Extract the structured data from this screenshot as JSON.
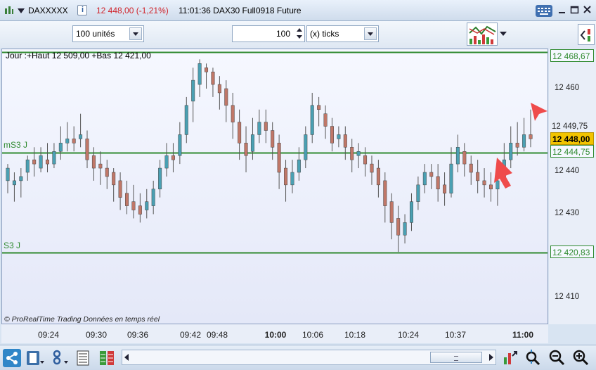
{
  "titlebar": {
    "instrument": "DAXXXXX",
    "info_icon": "i",
    "price_change": "12 448,00 (-1,21%)",
    "time_and_name": "11:01:36 DAX30 Full0918 Future",
    "colors": {
      "negative": "#d0232a"
    }
  },
  "toolbar": {
    "quantity": "100 unités",
    "step_value": "100",
    "step_unit": "(x) ticks"
  },
  "chart": {
    "header": "Jour :+Haut 12 509,00 +Bas 12 421,00",
    "label_ms3": "mS3 J",
    "label_s3": "S3 J",
    "footer_brand": "© ProRealTime Trading",
    "footer_realtime": "Données en temps réel",
    "colors": {
      "up": "#4aa0b3",
      "down": "#c07768",
      "level_line": "#2f8a2f",
      "last_price_bg": "#f2c400"
    }
  },
  "price_axis": {
    "tick_12460": "12 460",
    "tick_12440": "12 440",
    "tick_12430": "12 430",
    "tick_12410": "12 410",
    "level_high": "12 468,67",
    "level_ms3": "12 444,75",
    "level_s3": "12 420,83",
    "level_449": "12 449,75",
    "last_price": "12 448,00"
  },
  "time_axis": [
    "09:24",
    "09:30",
    "09:36",
    "09:42",
    "09:48",
    "10:00",
    "10:06",
    "10:18",
    "10:24",
    "10:37",
    "11:00"
  ],
  "chart_data": {
    "type": "candlestick",
    "header": "Jour :+Haut 12 509,00 +Bas 12 421,00",
    "yticks": [
      12460,
      12440,
      12430,
      12410
    ],
    "levels": [
      {
        "label": "",
        "value": 12468.67
      },
      {
        "label": "mS3 J",
        "value": 12444.75
      },
      {
        "label": "S3 J",
        "value": 12420.83
      }
    ],
    "last_price": 12448.0,
    "candles": [
      [
        12438,
        12441,
        12435,
        12442
      ],
      [
        12437,
        12438,
        12433,
        12440
      ],
      [
        12438,
        12439,
        12434,
        12441
      ],
      [
        12440,
        12443,
        12438,
        12444
      ],
      [
        12443,
        12442,
        12439,
        12446
      ],
      [
        12441,
        12444,
        12440,
        12446
      ],
      [
        12443,
        12442,
        12440,
        12447
      ],
      [
        12442,
        12445,
        12441,
        12447
      ],
      [
        12445,
        12447,
        12443,
        12451
      ],
      [
        12447,
        12448,
        12445,
        12452
      ],
      [
        12448,
        12447,
        12445,
        12451
      ],
      [
        12448,
        12449,
        12446,
        12454
      ],
      [
        12448,
        12443,
        12441,
        12450
      ],
      [
        12444,
        12441,
        12438,
        12446
      ],
      [
        12442,
        12441,
        12437,
        12445
      ],
      [
        12441,
        12439,
        12436,
        12443
      ],
      [
        12440,
        12437,
        12433,
        12441
      ],
      [
        12438,
        12434,
        12431,
        12440
      ],
      [
        12435,
        12432,
        12430,
        12438
      ],
      [
        12433,
        12431,
        12429,
        12437
      ],
      [
        12432,
        12430,
        12428,
        12435
      ],
      [
        12431,
        12433,
        12429,
        12436
      ],
      [
        12432,
        12436,
        12430,
        12438
      ],
      [
        12436,
        12441,
        12434,
        12443
      ],
      [
        12441,
        12444,
        12439,
        12447
      ],
      [
        12444,
        12443,
        12440,
        12447
      ],
      [
        12444,
        12449,
        12442,
        12452
      ],
      [
        12449,
        12456,
        12447,
        12458
      ],
      [
        12457,
        12462,
        12452,
        12465
      ],
      [
        12461,
        12466,
        12458,
        12467
      ],
      [
        12465,
        12464,
        12460,
        12466
      ],
      [
        12464,
        12461,
        12458,
        12465
      ],
      [
        12461,
        12459,
        12455,
        12463
      ],
      [
        12460,
        12456,
        12452,
        12462
      ],
      [
        12456,
        12452,
        12448,
        12459
      ],
      [
        12452,
        12447,
        12443,
        12455
      ],
      [
        12447,
        12444,
        12440,
        12451
      ],
      [
        12445,
        12449,
        12443,
        12453
      ],
      [
        12449,
        12452,
        12447,
        12455
      ],
      [
        12452,
        12450,
        12447,
        12455
      ],
      [
        12450,
        12446,
        12443,
        12452
      ],
      [
        12447,
        12440,
        12436,
        12449
      ],
      [
        12441,
        12437,
        12433,
        12443
      ],
      [
        12437,
        12440,
        12435,
        12443
      ],
      [
        12440,
        12443,
        12438,
        12446
      ],
      [
        12443,
        12449,
        12441,
        12451
      ],
      [
        12449,
        12456,
        12447,
        12459
      ],
      [
        12456,
        12455,
        12451,
        12458
      ],
      [
        12454,
        12451,
        12448,
        12456
      ],
      [
        12451,
        12447,
        12445,
        12453
      ],
      [
        12448,
        12449,
        12446,
        12451
      ],
      [
        12449,
        12446,
        12443,
        12451
      ],
      [
        12446,
        12443,
        12440,
        12448
      ],
      [
        12444,
        12445,
        12441,
        12447
      ],
      [
        12444,
        12442,
        12439,
        12446
      ],
      [
        12442,
        12440,
        12437,
        12444
      ],
      [
        12441,
        12437,
        12434,
        12443
      ],
      [
        12438,
        12432,
        12428,
        12440
      ],
      [
        12433,
        12428,
        12424,
        12435
      ],
      [
        12429,
        12425,
        12421,
        12432
      ],
      [
        12425,
        12428,
        12423,
        12430
      ],
      [
        12428,
        12433,
        12426,
        12435
      ],
      [
        12433,
        12437,
        12431,
        12439
      ],
      [
        12437,
        12440,
        12435,
        12442
      ],
      [
        12440,
        12439,
        12436,
        12442
      ],
      [
        12439,
        12436,
        12433,
        12442
      ],
      [
        12437,
        12435,
        12432,
        12440
      ],
      [
        12435,
        12442,
        12434,
        12446
      ],
      [
        12442,
        12446,
        12440,
        12449
      ],
      [
        12445,
        12442,
        12439,
        12447
      ],
      [
        12442,
        12440,
        12437,
        12444
      ],
      [
        12440,
        12438,
        12435,
        12443
      ],
      [
        12438,
        12437,
        12434,
        12441
      ],
      [
        12437,
        12436,
        12433,
        12440
      ],
      [
        12436,
        12438,
        12432,
        12441
      ],
      [
        12438,
        12443,
        12437,
        12447
      ],
      [
        12443,
        12447,
        12441,
        12451
      ],
      [
        12447,
        12446,
        12444,
        12452
      ],
      [
        12446,
        12449,
        12445,
        12453
      ],
      [
        12449,
        12448,
        12446,
        12455
      ]
    ]
  }
}
